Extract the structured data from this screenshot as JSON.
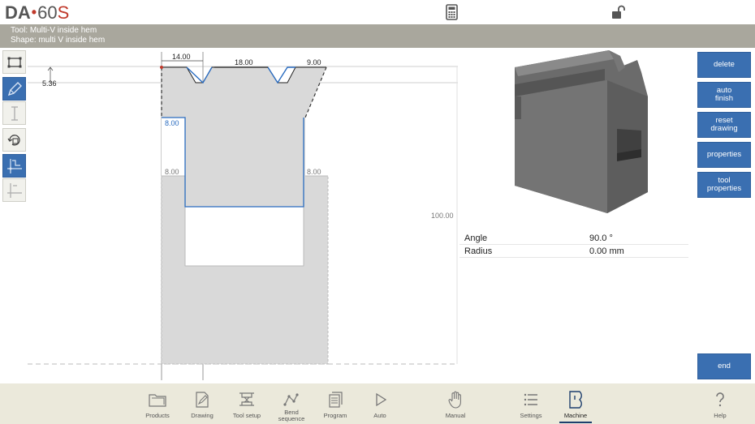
{
  "header": {
    "brand_left": "DA",
    "brand_model": "60",
    "brand_model_suffix": "S"
  },
  "info": {
    "tool_line": "Tool: Multi-V inside hem",
    "shape_line": "Shape: multi V inside hem"
  },
  "toolbar_icons": [
    "zoom-fit-icon",
    "pencil-icon",
    "dimension-icon",
    "rotate-icon",
    "snap-icon",
    "axis-icon"
  ],
  "drawing": {
    "dims": {
      "top1": "14.00",
      "top2": "18.00",
      "top3": "9.00",
      "offset": "5.36",
      "left_blue": "8.00",
      "left_grey": "8.00",
      "right_grey": "8.00",
      "height": "100.00"
    }
  },
  "properties": [
    {
      "key": "Angle",
      "value": "90.0 °"
    },
    {
      "key": "Radius",
      "value": "0.00 mm"
    }
  ],
  "actions": {
    "delete": "delete",
    "auto_finish_1": "auto",
    "auto_finish_2": "finish",
    "reset_drawing_1": "reset",
    "reset_drawing_2": "drawing",
    "properties": "properties",
    "tool_properties_1": "tool",
    "tool_properties_2": "properties",
    "end": "end"
  },
  "nav": [
    {
      "label": "Products"
    },
    {
      "label": "Drawing"
    },
    {
      "label": "Tool setup"
    },
    {
      "label": "Bend",
      "label2": "sequence"
    },
    {
      "label": "Program"
    },
    {
      "label": "Auto"
    },
    {
      "label": "Manual"
    },
    {
      "label": "Settings"
    },
    {
      "label": "Machine"
    },
    {
      "label": "Help"
    }
  ],
  "colors": {
    "accent_blue": "#3a6fb1",
    "info_bar": "#a9a79d",
    "nav_bg": "#ebe9db",
    "tool_fill": "#d9d9d9",
    "model_grey": "#6e6e6e"
  }
}
